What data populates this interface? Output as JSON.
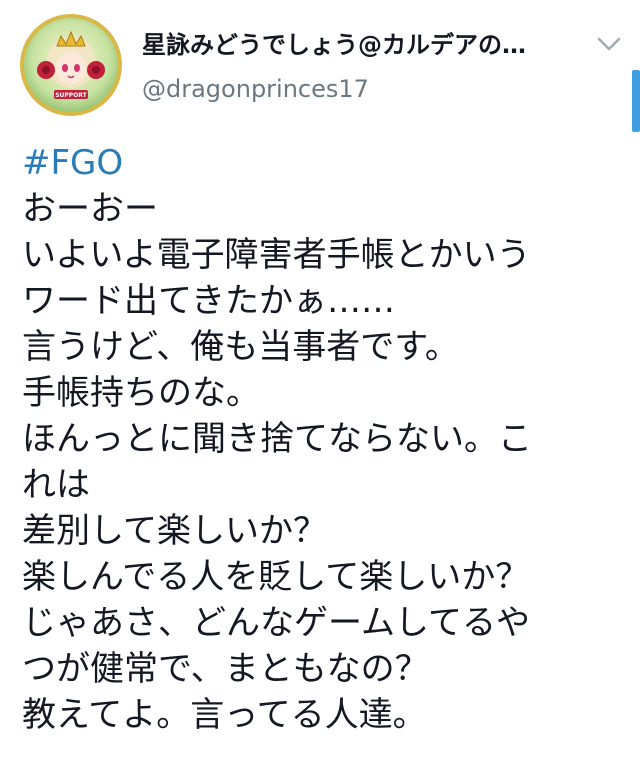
{
  "header": {
    "display_name": "星詠みどうでしょう@カルデアの…",
    "username": "@dragonprinces17",
    "avatar_badge": "SUPPORT"
  },
  "tweet": {
    "hashtag": "#FGO",
    "lines": [
      "おーおー",
      "いよいよ電子障害者手帳とかいう",
      "ワード出てきたかぁ……",
      "言うけど、俺も当事者です。",
      "手帳持ちのな。",
      "ほんっとに聞き捨てならない。こ",
      "れは",
      "差別して楽しいか？",
      "楽しんでる人を貶して楽しいか？",
      "じゃあさ、どんなゲームしてるや",
      "つが健常で、まともなの？",
      "教えてよ。言ってる人達。"
    ]
  },
  "colors": {
    "hashtag": "#2b7bb9",
    "username": "#697882",
    "scroll_indicator": "#3f9fe0",
    "chevron": "#a0aab2"
  },
  "icons": {
    "menu": "chevron-down-icon"
  }
}
